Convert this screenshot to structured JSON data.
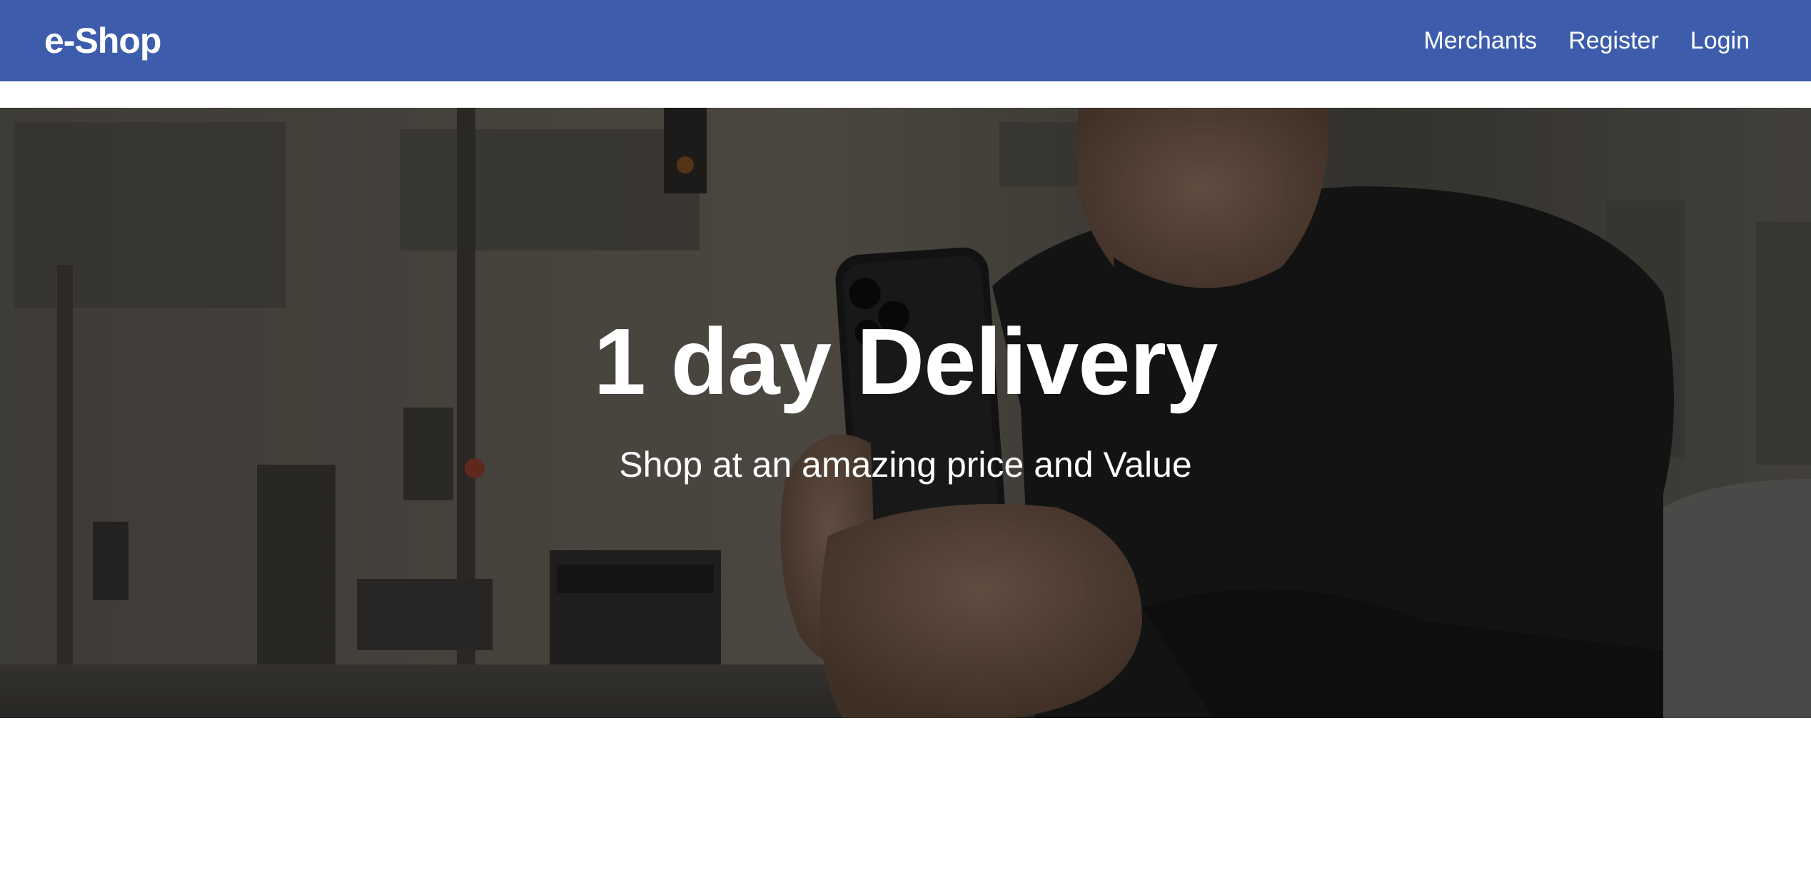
{
  "navbar": {
    "brand": "e-Shop",
    "links": [
      {
        "label": "Merchants"
      },
      {
        "label": "Register"
      },
      {
        "label": "Login"
      }
    ],
    "background_color": "#3d5dac"
  },
  "hero": {
    "title": "1 day Delivery",
    "subtitle": "Shop at an amazing price and Value",
    "background_image": "person holding smartphone on city street"
  }
}
